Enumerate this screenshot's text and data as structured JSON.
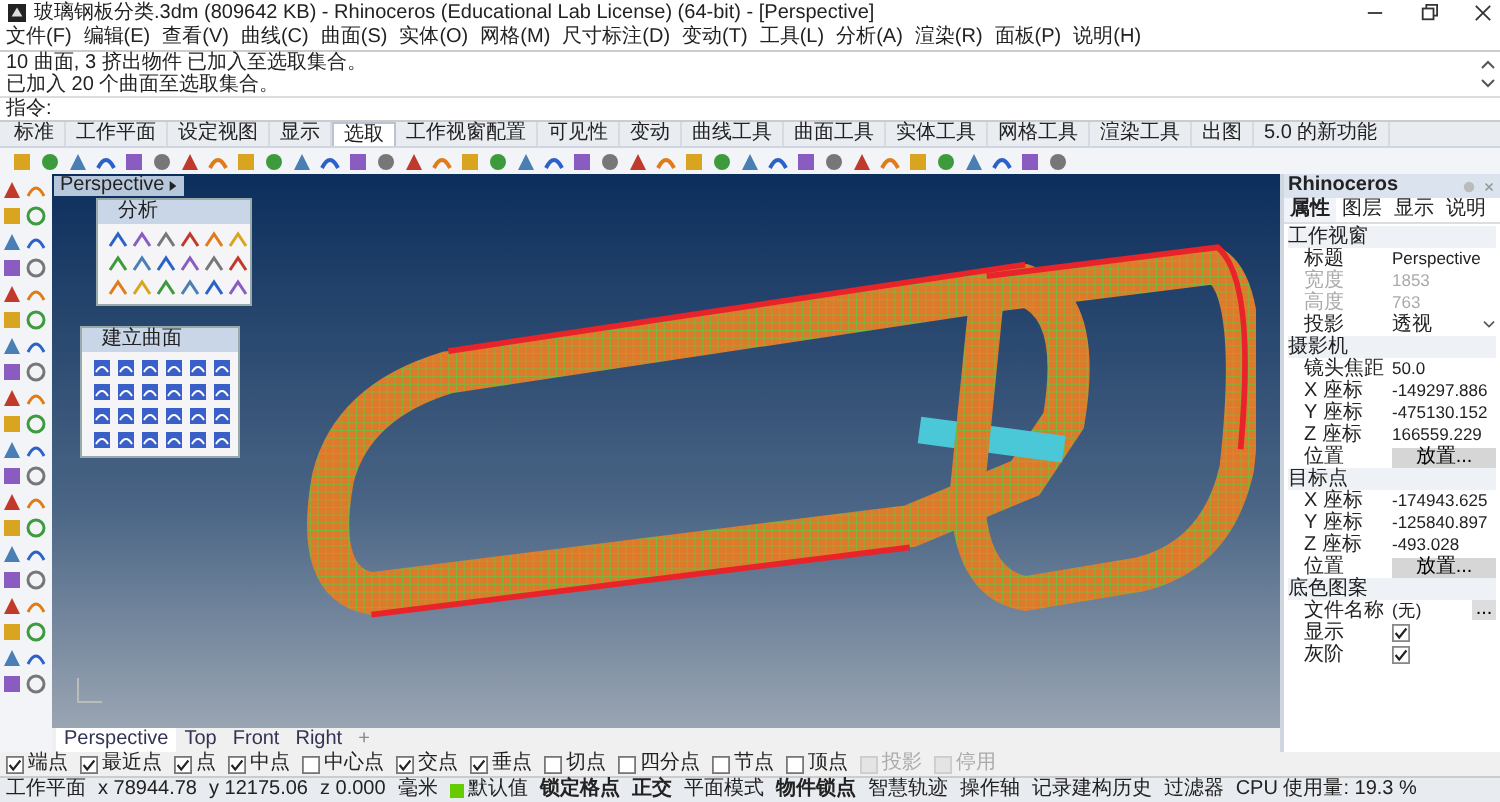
{
  "window": {
    "title": "玻璃钢板分类.3dm (809642 KB) - Rhinoceros (Educational Lab License) (64-bit) - [Perspective]"
  },
  "menu": [
    "文件(F)",
    "编辑(E)",
    "查看(V)",
    "曲线(C)",
    "曲面(S)",
    "实体(O)",
    "网格(M)",
    "尺寸标注(D)",
    "变动(T)",
    "工具(L)",
    "分析(A)",
    "渲染(R)",
    "面板(P)",
    "说明(H)"
  ],
  "command": {
    "history": [
      "10 曲面, 3 挤出物件 已加入至选取集合。",
      "已加入 20 个曲面至选取集合。"
    ],
    "prompt": "指令:"
  },
  "tabs": [
    {
      "label": "标准",
      "selected": false
    },
    {
      "label": "工作平面",
      "selected": false
    },
    {
      "label": "设定视图",
      "selected": false
    },
    {
      "label": "显示",
      "selected": false
    },
    {
      "label": "选取",
      "selected": true
    },
    {
      "label": "工作视窗配置",
      "selected": false
    },
    {
      "label": "可见性",
      "selected": false
    },
    {
      "label": "变动",
      "selected": false
    },
    {
      "label": "曲线工具",
      "selected": false
    },
    {
      "label": "曲面工具",
      "selected": false
    },
    {
      "label": "实体工具",
      "selected": false
    },
    {
      "label": "网格工具",
      "selected": false
    },
    {
      "label": "渲染工具",
      "selected": false
    },
    {
      "label": "出图",
      "selected": false
    },
    {
      "label": "5.0 的新功能",
      "selected": false
    }
  ],
  "viewport": {
    "title": "Perspective"
  },
  "floating_panels": [
    {
      "title": "分析"
    },
    {
      "title": "建立曲面"
    }
  ],
  "properties_panel": {
    "title": "Rhinoceros",
    "tabs": [
      {
        "label": "属性",
        "selected": true
      },
      {
        "label": "图层",
        "selected": false
      },
      {
        "label": "显示",
        "selected": false
      },
      {
        "label": "说明",
        "selected": false
      }
    ],
    "sections": [
      {
        "title": "工作视窗",
        "rows": [
          {
            "kind": "text",
            "label": "标题",
            "value": "Perspective",
            "disabled": false
          },
          {
            "kind": "text",
            "label": "宽度",
            "value": "1853",
            "disabled": true
          },
          {
            "kind": "text",
            "label": "高度",
            "value": "763",
            "disabled": true
          },
          {
            "kind": "dropdown",
            "label": "投影",
            "value": "透视",
            "disabled": false
          }
        ]
      },
      {
        "title": "摄影机",
        "rows": [
          {
            "kind": "text",
            "label": "镜头焦距",
            "value": "50.0",
            "disabled": false
          },
          {
            "kind": "text",
            "label": "X 座标",
            "value": "-149297.886",
            "disabled": false
          },
          {
            "kind": "text",
            "label": "Y 座标",
            "value": "-475130.152",
            "disabled": false
          },
          {
            "kind": "text",
            "label": "Z 座标",
            "value": "166559.229",
            "disabled": false
          },
          {
            "kind": "button",
            "label": "位置",
            "value": "放置...",
            "disabled": false
          }
        ]
      },
      {
        "title": "目标点",
        "rows": [
          {
            "kind": "text",
            "label": "X 座标",
            "value": "-174943.625",
            "disabled": false
          },
          {
            "kind": "text",
            "label": "Y 座标",
            "value": "-125840.897",
            "disabled": false
          },
          {
            "kind": "text",
            "label": "Z 座标",
            "value": "-493.028",
            "disabled": false
          },
          {
            "kind": "button",
            "label": "位置",
            "value": "放置...",
            "disabled": false
          }
        ]
      },
      {
        "title": "底色图案",
        "rows": [
          {
            "kind": "file",
            "label": "文件名称",
            "value": "(无)",
            "button": "...",
            "disabled": false
          },
          {
            "kind": "check",
            "label": "显示",
            "checked": true,
            "disabled": false
          },
          {
            "kind": "check",
            "label": "灰阶",
            "checked": true,
            "disabled": false
          }
        ]
      }
    ]
  },
  "viewport_tabs": [
    {
      "label": "Perspective",
      "selected": true
    },
    {
      "label": "Top",
      "selected": false
    },
    {
      "label": "Front",
      "selected": false
    },
    {
      "label": "Right",
      "selected": false
    }
  ],
  "new_viewport_tab": "+",
  "osnaps": [
    {
      "label": "端点",
      "checked": true,
      "disabled": false
    },
    {
      "label": "最近点",
      "checked": true,
      "disabled": false
    },
    {
      "label": "点",
      "checked": true,
      "disabled": false
    },
    {
      "label": "中点",
      "checked": true,
      "disabled": false
    },
    {
      "label": "中心点",
      "checked": false,
      "disabled": false
    },
    {
      "label": "交点",
      "checked": true,
      "disabled": false
    },
    {
      "label": "垂点",
      "checked": true,
      "disabled": false
    },
    {
      "label": "切点",
      "checked": false,
      "disabled": false
    },
    {
      "label": "四分点",
      "checked": false,
      "disabled": false
    },
    {
      "label": "节点",
      "checked": false,
      "disabled": false
    },
    {
      "label": "顶点",
      "checked": false,
      "disabled": false
    },
    {
      "label": "投影",
      "checked": false,
      "disabled": true
    },
    {
      "label": "停用",
      "checked": false,
      "disabled": true
    }
  ],
  "status_bar": {
    "coords": [
      "工作平面",
      "x 78944.78",
      "y 12175.06",
      "z 0.000"
    ],
    "units": "毫米",
    "layer": {
      "name": "默认值",
      "color": "#66cc00"
    },
    "toggles": [
      {
        "label": "锁定格点",
        "on": true
      },
      {
        "label": "正交",
        "on": true
      },
      {
        "label": "平面模式",
        "on": false
      },
      {
        "label": "物件锁点",
        "on": true
      },
      {
        "label": "智慧轨迹",
        "on": false
      },
      {
        "label": "操作轴",
        "on": false
      },
      {
        "label": "记录建构历史",
        "on": false
      },
      {
        "label": "过滤器",
        "on": false
      }
    ],
    "cpu": "CPU 使用量: 19.3 %"
  }
}
